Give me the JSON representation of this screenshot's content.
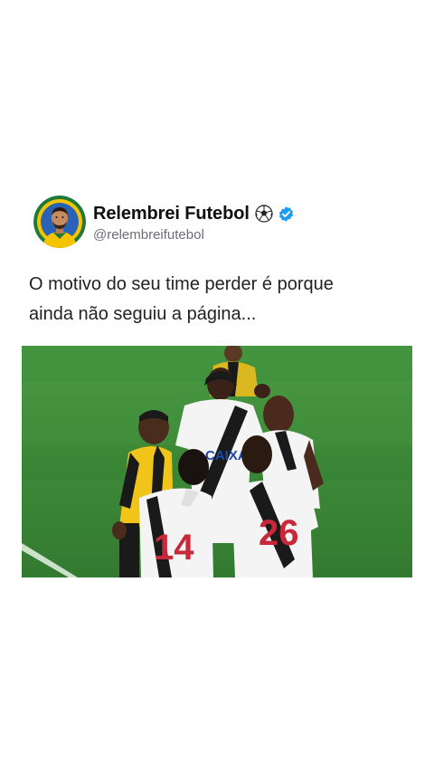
{
  "post": {
    "author": {
      "display_name": "Relembrei Futebol",
      "handle": "@relembreifutebol",
      "avatar_icon": "avatar-illustration",
      "emoji_icon": "soccer-ball-icon",
      "verified_icon": "verified-badge-icon",
      "verified_color": "#1d9bf0"
    },
    "caption": "O motivo do seu time perder é porque\nainda não seguiu a página...",
    "media": {
      "type": "photo",
      "shirt_texts": {
        "sponsor": "CAIXA",
        "number_left": "14",
        "number_right": "26"
      },
      "colors": {
        "pitch": "#3f8a3a",
        "kit_white": "#f4f4f4",
        "kit_sash": "#1a1a1a",
        "number_red": "#c8283a",
        "referee_yellow": "#f0c419"
      }
    }
  }
}
